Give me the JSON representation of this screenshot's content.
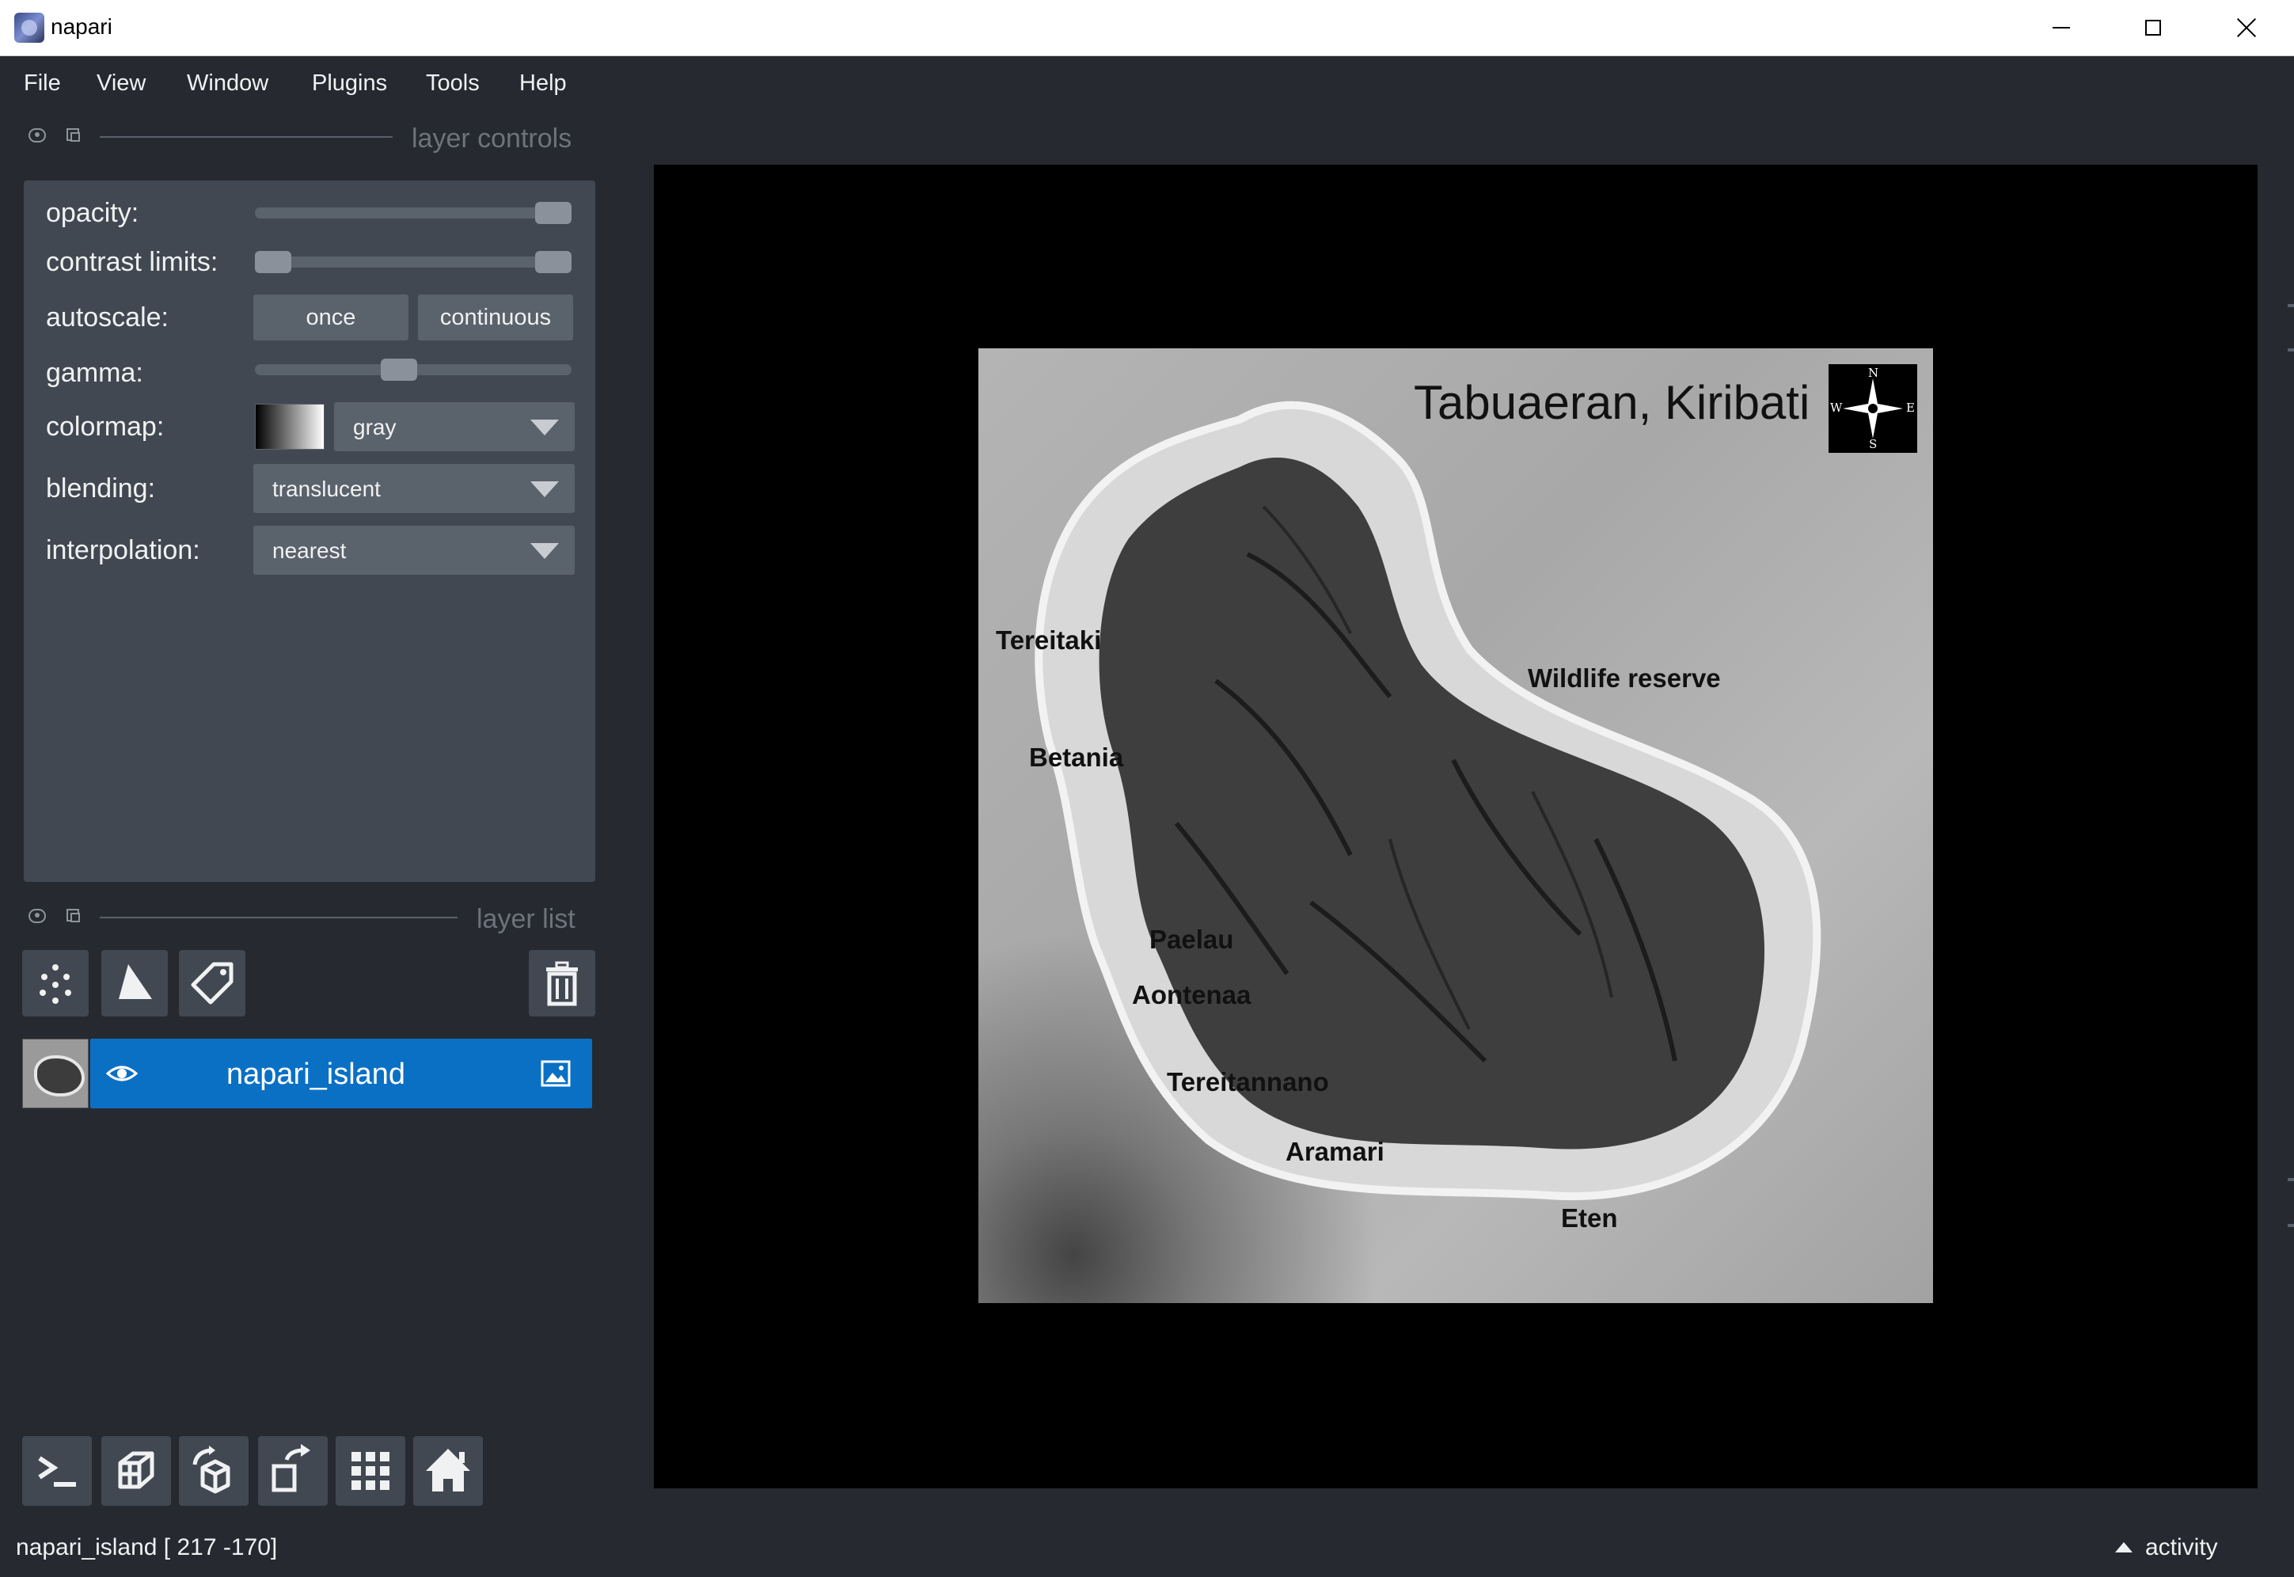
{
  "window": {
    "title": "napari"
  },
  "menu": [
    "File",
    "View",
    "Window",
    "Plugins",
    "Tools",
    "Help"
  ],
  "layer_controls": {
    "title": "layer controls",
    "opacity": {
      "label": "opacity:",
      "value": 1.0
    },
    "contrast_limits": {
      "label": "contrast limits:",
      "min": 0.0,
      "max": 1.0
    },
    "autoscale": {
      "label": "autoscale:",
      "once": "once",
      "continuous": "continuous"
    },
    "gamma": {
      "label": "gamma:",
      "value": 0.45
    },
    "colormap": {
      "label": "colormap:",
      "value": "gray"
    },
    "blending": {
      "label": "blending:",
      "value": "translucent"
    },
    "interpolation": {
      "label": "interpolation:",
      "value": "nearest"
    }
  },
  "layer_list": {
    "title": "layer list",
    "layers": [
      {
        "name": "napari_island",
        "visible": true,
        "type": "image"
      }
    ]
  },
  "status": {
    "text": "napari_island [ 217 -170]",
    "activity": "activity"
  },
  "image": {
    "title": "Tabuaeran, Kiribati",
    "compass": {
      "n": "N",
      "s": "S",
      "e": "E",
      "w": "W"
    },
    "places": [
      "Tereitaki",
      "Wildlife reserve",
      "Betania",
      "Paelau",
      "Aontenaa",
      "Tereitannano",
      "Aramari",
      "Eten"
    ]
  },
  "colors": {
    "accent": "#0a70c4",
    "background": "#262930",
    "panel": "#414851",
    "control": "#5a626c"
  }
}
